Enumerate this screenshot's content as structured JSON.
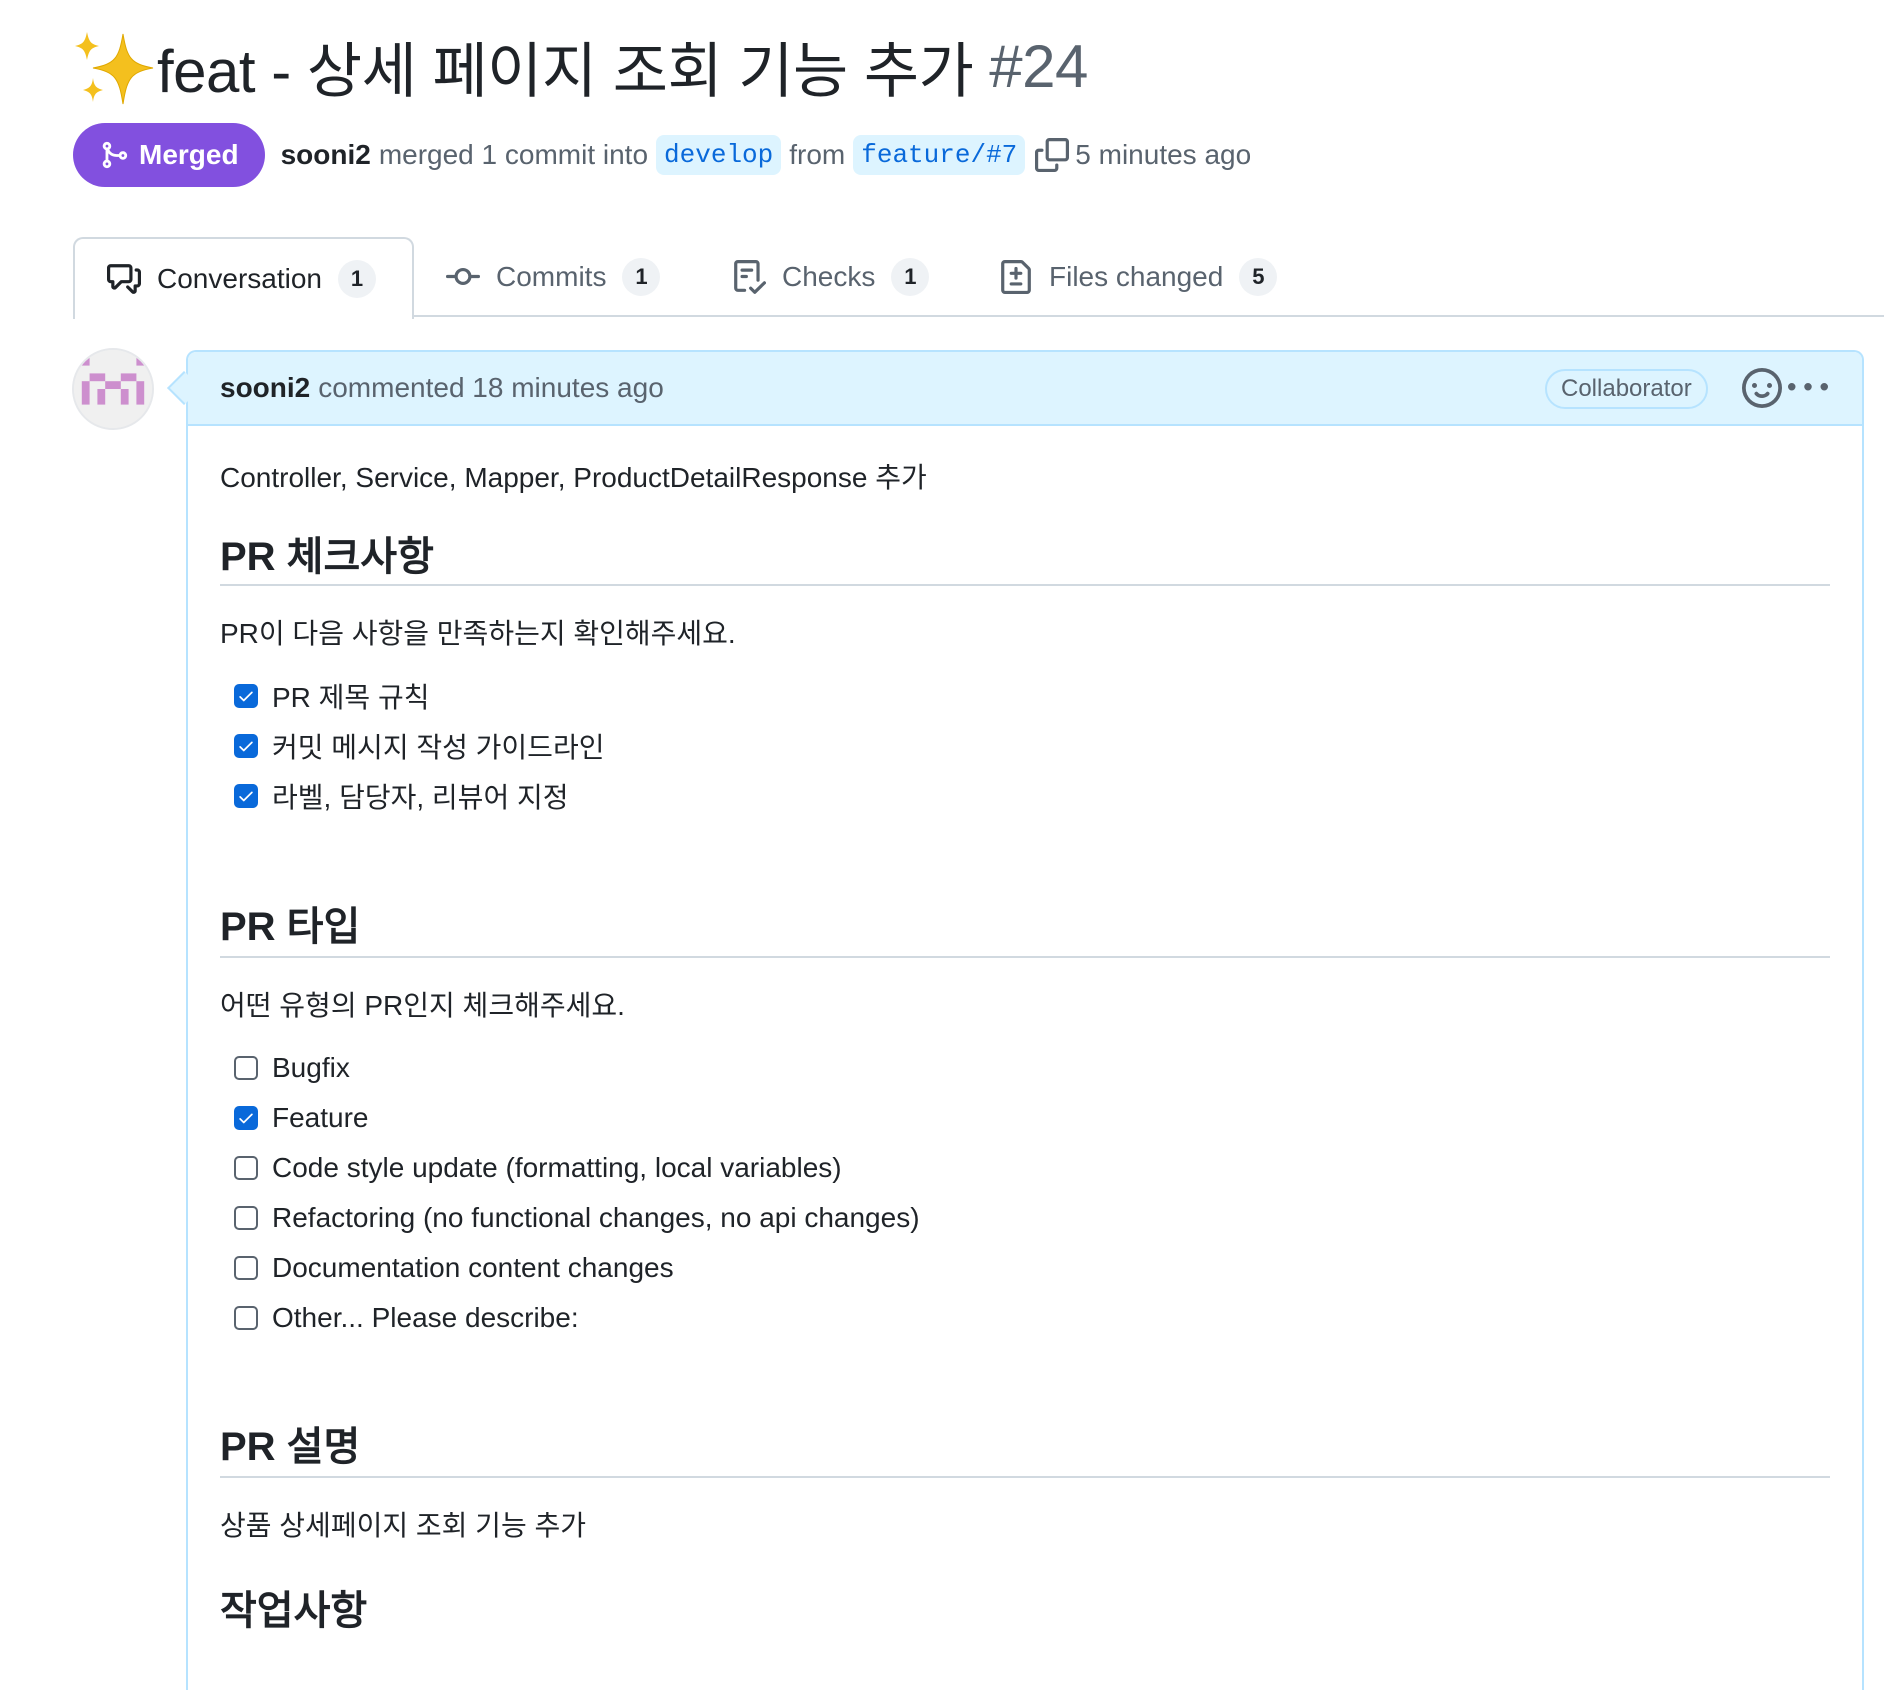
{
  "header": {
    "title": "feat - 상세 페이지 조회 기능 추가",
    "number": "#24",
    "status": "Merged",
    "author": "sooni2",
    "merge_text": "merged 1 commit into",
    "base_branch": "develop",
    "from_text": "from",
    "head_branch": "feature/#7",
    "time": "5 minutes ago"
  },
  "tabs": [
    {
      "label": "Conversation",
      "count": "1"
    },
    {
      "label": "Commits",
      "count": "1"
    },
    {
      "label": "Checks",
      "count": "1"
    },
    {
      "label": "Files changed",
      "count": "5"
    }
  ],
  "comment": {
    "author": "sooni2",
    "meta": "commented 18 minutes ago",
    "role": "Collaborator",
    "intro": "Controller, Service, Mapper, ProductDetailResponse 추가",
    "sections": [
      {
        "heading": "PR 체크사항",
        "text": "PR이 다음 사항을 만족하는지 확인해주세요.",
        "tasks": [
          {
            "label": "PR 제목 규칙",
            "checked": true
          },
          {
            "label": "커밋 메시지 작성 가이드라인",
            "checked": true
          },
          {
            "label": "라벨, 담당자, 리뷰어 지정",
            "checked": true
          }
        ]
      },
      {
        "heading": "PR 타입",
        "text": "어떤 유형의 PR인지 체크해주세요.",
        "tasks": [
          {
            "label": "Bugfix",
            "checked": false
          },
          {
            "label": "Feature",
            "checked": true
          },
          {
            "label": "Code style update (formatting, local variables)",
            "checked": false
          },
          {
            "label": "Refactoring (no functional changes, no api changes)",
            "checked": false
          },
          {
            "label": "Documentation content changes",
            "checked": false
          },
          {
            "label": "Other... Please describe:",
            "checked": false
          }
        ]
      },
      {
        "heading": "PR 설명",
        "text": "상품 상세페이지 조회 기능 추가"
      },
      {
        "heading": "작업사항"
      }
    ]
  },
  "colors": {
    "merged": "#8250df",
    "accent": "#0969da",
    "header_bg": "#ddf4ff",
    "border": "#b6e3ff"
  },
  "icons": [
    "sparkles-icon",
    "git-merge-icon",
    "copy-icon",
    "conversation-icon",
    "commit-icon",
    "checklist-icon",
    "file-diff-icon",
    "smiley-icon",
    "kebab-horizontal-icon"
  ]
}
